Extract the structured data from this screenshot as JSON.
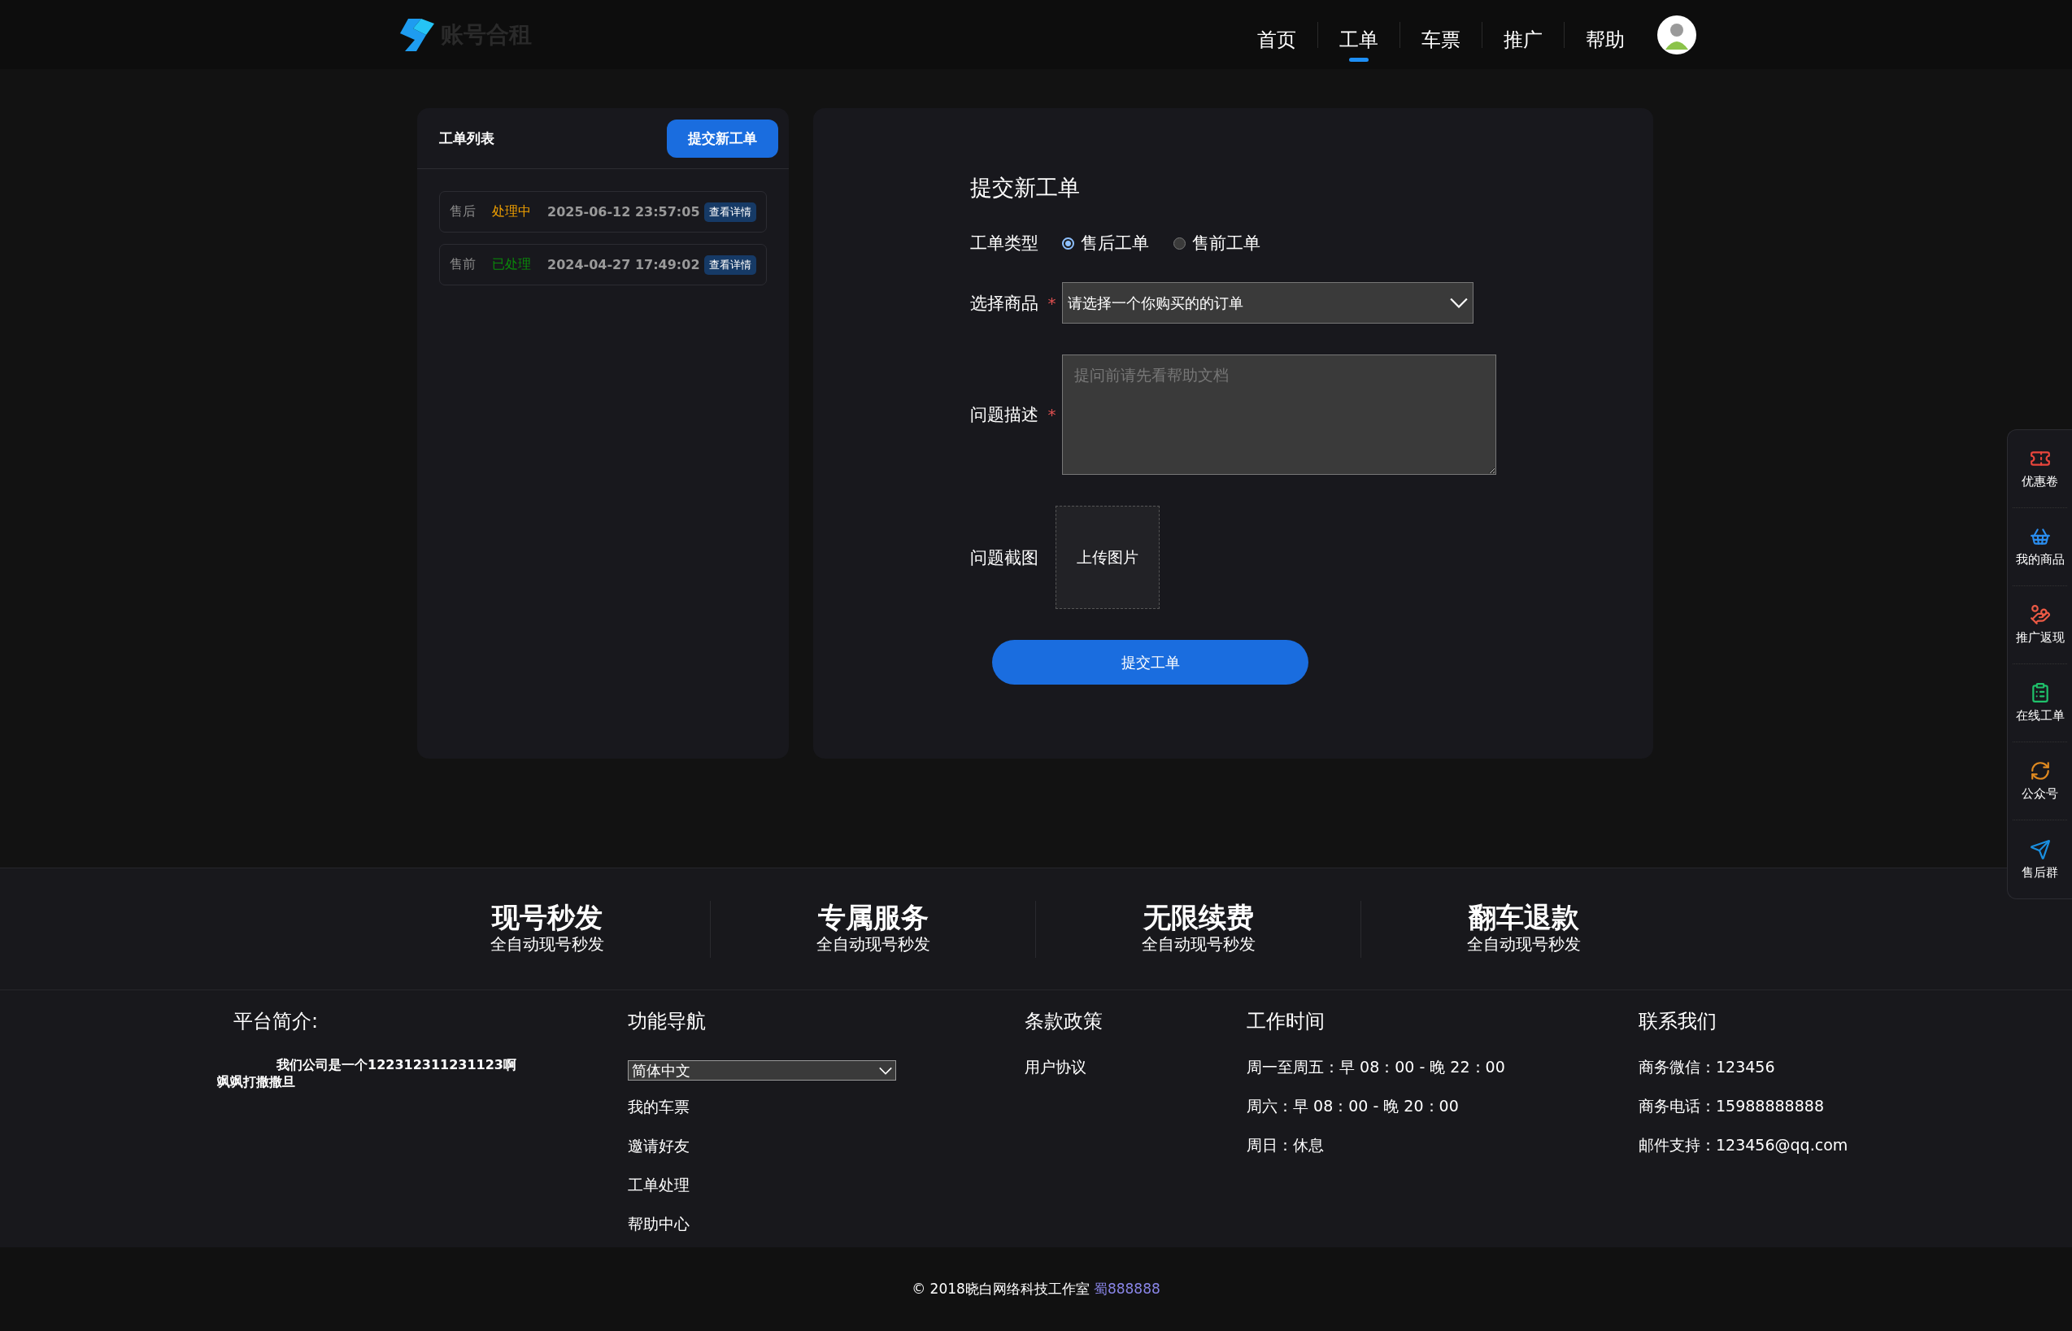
{
  "header": {
    "logo_text": "账号合租",
    "nav": [
      {
        "label": "首页",
        "selected": false
      },
      {
        "label": "工单",
        "selected": true
      },
      {
        "label": "车票",
        "selected": false
      },
      {
        "label": "推广",
        "selected": false
      },
      {
        "label": "帮助",
        "selected": false
      }
    ]
  },
  "ticket_list": {
    "title": "工单列表",
    "new_button": "提交新工单",
    "tickets": [
      {
        "type": "售后",
        "status": "处理中",
        "color": "#f0a000",
        "time": "2025-06-12 23:57:05",
        "action": "查看详情"
      },
      {
        "type": "售前",
        "status": "已处理",
        "color": "#0a8a0a",
        "time": "2024-04-27 17:49:02",
        "action": "查看详情"
      }
    ]
  },
  "form": {
    "title": "提交新工单",
    "fields": [
      {
        "kind": "radio",
        "label": "工单类型",
        "options": [
          {
            "label": "售后工单",
            "selected": true
          },
          {
            "label": "售前工单",
            "selected": false
          }
        ]
      },
      {
        "kind": "select",
        "label": "选择商品",
        "required_mark": "*",
        "value": "请选择一个你购买的的订单"
      },
      {
        "kind": "textarea",
        "label": "问题描述",
        "required_mark": "*",
        "placeholder": "提问前请先看帮助文档"
      },
      {
        "kind": "upload",
        "label": "问题截图",
        "button": "上传图片"
      }
    ],
    "submit": "提交工单"
  },
  "side_dock": [
    {
      "label": "优惠卷"
    },
    {
      "label": "我的商品"
    },
    {
      "label": "推广返现"
    },
    {
      "label": "在线工单"
    },
    {
      "label": "公众号"
    },
    {
      "label": "售后群"
    }
  ],
  "features": [
    {
      "title": "现号秒发",
      "subtitle": "全自动现号秒发"
    },
    {
      "title": "专属服务",
      "subtitle": "全自动现号秒发"
    },
    {
      "title": "无限续费",
      "subtitle": "全自动现号秒发"
    },
    {
      "title": "翻车退款",
      "subtitle": "全自动现号秒发"
    }
  ],
  "footer": {
    "about": {
      "title": "平台简介:",
      "lines": [
        "我们公司是一个122312311231123啊",
        "飒飒打撒撒旦"
      ]
    },
    "nav": {
      "title": "功能导航",
      "language": "简体中文",
      "links": [
        "我的车票",
        "邀请好友",
        "工单处理",
        "帮助中心"
      ]
    },
    "policy": {
      "title": "条款政策",
      "links": [
        "用户协议"
      ]
    },
    "hours": {
      "title": "工作时间",
      "lines": [
        "周一至周五：早 08：00 - 晚 22：00",
        "周六：早 08：00 - 晚 20：00",
        "周日：休息"
      ]
    },
    "contact": {
      "title": "联系我们",
      "lines": [
        "商务微信：123456",
        "商务电话：15988888888",
        "邮件支持：123456@qq.com"
      ]
    }
  },
  "copyright": {
    "text": "© 2018晓白网络科技工作室",
    "link": "蜀888888"
  }
}
